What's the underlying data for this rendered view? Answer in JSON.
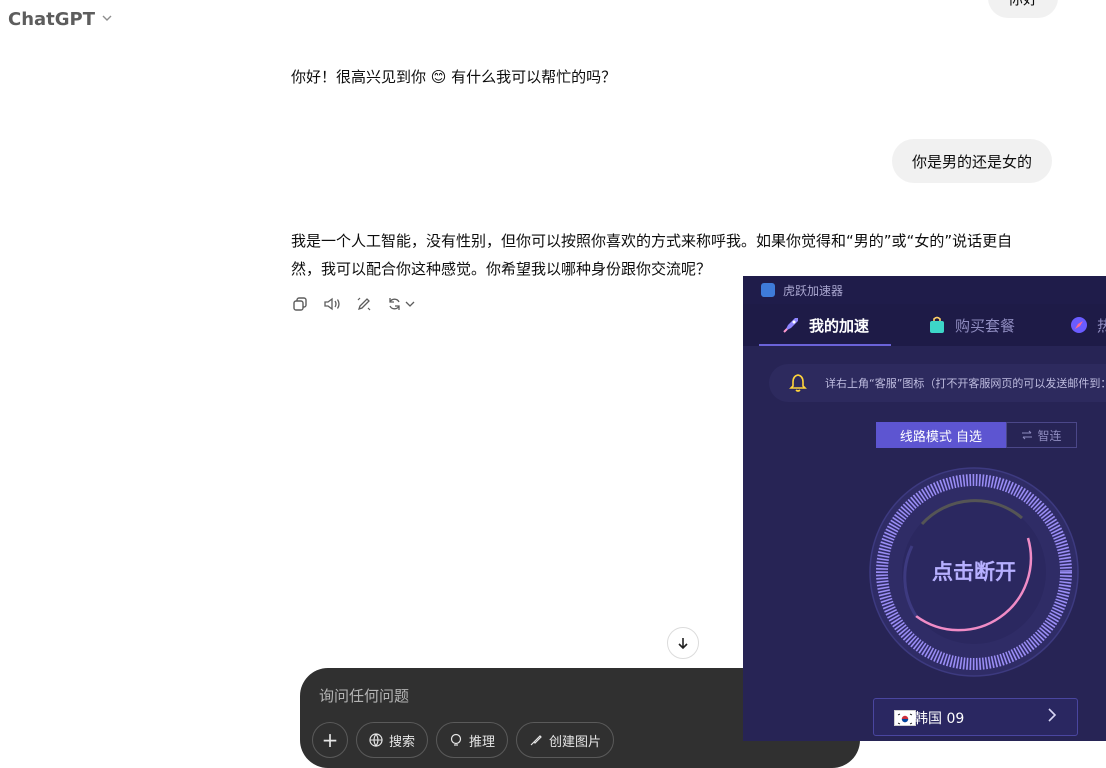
{
  "header": {
    "app_title": "ChatGPT",
    "chevron_icon": "chevron-down-icon"
  },
  "chat": {
    "user_msg_1": "你好",
    "assistant_msg_1": "你好！很高兴见到你 😊 有什么我可以帮忙的吗？",
    "user_msg_2": "你是男的还是女的",
    "assistant_msg_2_line1": "我是一个人工智能，没有性别，但你可以按照你喜欢的方式来称呼我。如果你觉得和“男的”或“女的”说话更自",
    "assistant_msg_2_line2": "然，我可以配合你这种感觉。你希望我以哪种身份跟你交流呢？",
    "action_icons": [
      "copy-icon",
      "read-aloud-icon",
      "edit-icon",
      "regenerate-icon"
    ]
  },
  "composer": {
    "placeholder": "询问任何问题",
    "add_label": "+",
    "search_label": "搜索",
    "reason_label": "推理",
    "image_label": "创建图片"
  },
  "accelerator": {
    "window_title": "虎跃加速器",
    "tabs": [
      {
        "label": "我的加速",
        "active": true
      },
      {
        "label": "购买套餐",
        "active": false
      },
      {
        "label": "热",
        "active": false
      }
    ],
    "notice": "详右上角“客服”图标（打不开客服网页的可以发送邮件到：h",
    "mode_selected": "线路模式 自选",
    "mode_alt": "智连",
    "dial_button": "点击断开",
    "region": "韩国 09",
    "colors": {
      "bg": "#272455",
      "accent": "#5d55d1",
      "dial_text": "#b7b0ff",
      "arc_pink": "#f08cc6"
    }
  }
}
